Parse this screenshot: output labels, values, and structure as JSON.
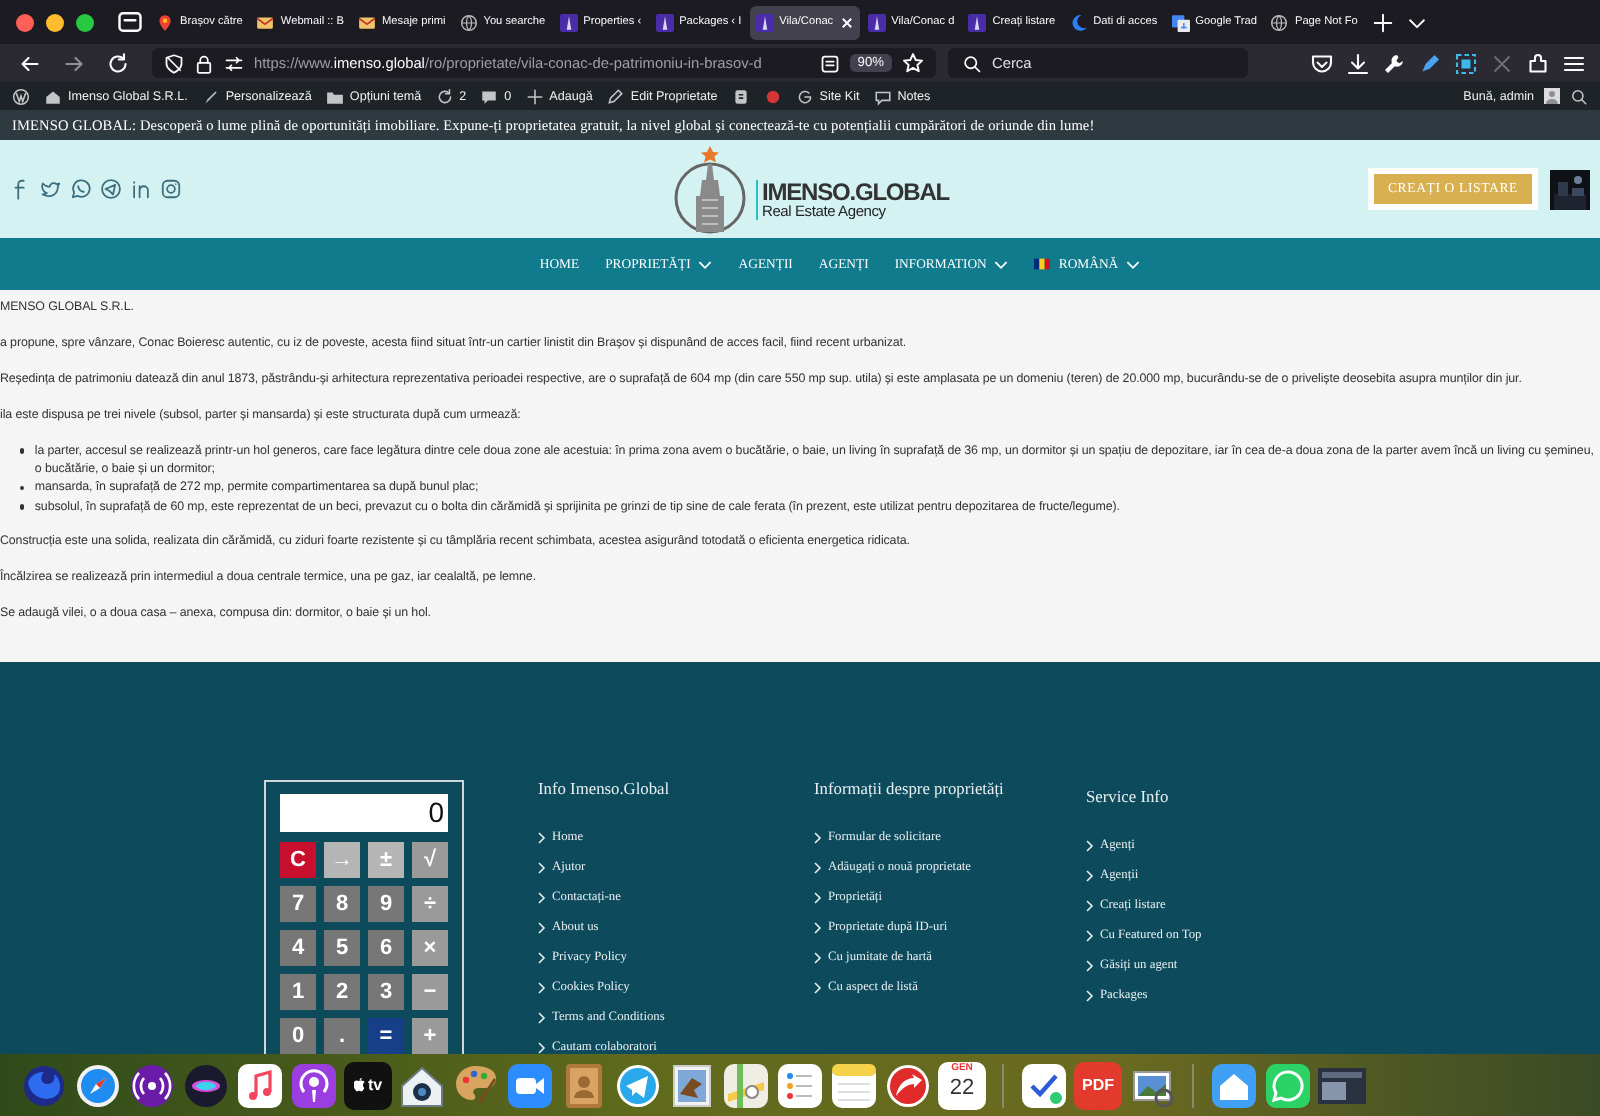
{
  "browser": {
    "tabs": [
      {
        "title": "Brașov către",
        "selected": false
      },
      {
        "title": "Webmail :: B",
        "selected": false
      },
      {
        "title": "Mesaje primi",
        "selected": false
      },
      {
        "title": "You searche",
        "selected": false
      },
      {
        "title": "Properties ‹",
        "selected": false
      },
      {
        "title": "Packages ‹ I",
        "selected": false
      },
      {
        "title": "Vila/Conac",
        "selected": true
      },
      {
        "title": "Vila/Conac d",
        "selected": false
      },
      {
        "title": "Creați listare",
        "selected": false
      },
      {
        "title": "Dati di acces",
        "selected": false
      },
      {
        "title": "Google Trad",
        "selected": false
      },
      {
        "title": "Page Not Fo",
        "selected": false
      }
    ],
    "url": "https://www.**imenso.global**/ro/proprietate/vila-conac-de-patrimoniu-in-brasov-d",
    "zoom": "90%",
    "search": {
      "placeholder": "Cerca"
    }
  },
  "admin_bar": {
    "items": [
      {
        "kind": "wordpress"
      },
      {
        "kind": "site",
        "label": "Imenso Global S.R.L."
      },
      {
        "kind": "customize",
        "label": "Personalizează"
      },
      {
        "kind": "theme",
        "label": "Opțiuni temă"
      },
      {
        "kind": "updates",
        "label": "2"
      },
      {
        "kind": "comments",
        "label": "0"
      },
      {
        "kind": "new",
        "label": "Adaugă"
      },
      {
        "kind": "edit",
        "label": "Edit Proprietate"
      },
      {
        "kind": "plugin"
      },
      {
        "kind": "status"
      },
      {
        "kind": "sitekit",
        "label": "Site Kit"
      },
      {
        "kind": "notes",
        "label": "Notes"
      }
    ],
    "greeting": "Bună, admin"
  },
  "announcement": "IMENSO GLOBAL: Descoperă o lume plină de oportunități imobiliare. Expune-ți proprietatea gratuit, la nivel global și conectează-te cu potențialii cumpărători de oriunde din lume!",
  "header": {
    "social": [
      {
        "kind": "facebook"
      },
      {
        "kind": "twitter"
      },
      {
        "kind": "whatsapp"
      },
      {
        "kind": "telegram"
      },
      {
        "kind": "linkedin"
      },
      {
        "kind": "instagram"
      }
    ],
    "logo": {
      "title": "IMENSO.GLOBAL",
      "subtitle": "Real Estate Agency"
    },
    "button": "CREAȚI O LISTARE"
  },
  "nav": [
    {
      "label": "HOME",
      "dropdown": false,
      "kind": "link"
    },
    {
      "label": "PROPRIETĂȚI",
      "dropdown": true,
      "kind": "link"
    },
    {
      "label": "AGENȚII",
      "dropdown": false,
      "kind": "link"
    },
    {
      "label": "AGENȚI",
      "dropdown": false,
      "kind": "link"
    },
    {
      "label": "INFORMATION",
      "dropdown": true,
      "kind": "link"
    },
    {
      "label": "ROMÂNĂ",
      "dropdown": true,
      "kind": "language"
    }
  ],
  "content": [
    {
      "kind": "paragraph",
      "text": "MENSO GLOBAL S.R.L."
    },
    {
      "kind": "paragraph",
      "text": "a propune, spre vânzare, Conac Boieresc autentic, cu iz de poveste, acesta fiind situat într-un cartier linistit din Brașov și dispunând de acces facil, fiind recent urbanizat."
    },
    {
      "kind": "paragraph",
      "text": "Reședința de patrimoniu datează din anul 1873, păstrându-și arhitectura reprezentativa perioadei respective, are o suprafață de 604 mp (din care 550 mp sup. utila) și este amplasata pe un domeniu (teren) de 20.000 mp, bucurându-se de o priveliște deosebita asupra munților din jur."
    },
    {
      "kind": "paragraph",
      "text": "ila este dispusa pe trei nivele (subsol, parter și mansarda) și este structurata după cum urmează:"
    },
    {
      "kind": "list",
      "items": [
        "la parter, accesul se realizează printr-un hol generos, care face legătura dintre cele doua zone ale acestuia: în prima zona avem o bucătărie, o baie, un living în suprafață de 36 mp, un dormitor și un spațiu de depozitare, iar în cea de-a doua zona de la parter avem încă un living cu șemineu, o bucătărie, o baie și un dormitor;",
        "mansarda, în suprafață de 272 mp, permite compartimentarea sa după bunul plac;",
        "subsolul, în suprafață de 60 mp, este reprezentat de un beci, prevazut cu o bolta din cărămidă și sprijinita pe grinzi de tip sine de cale ferata (în prezent, este utilizat pentru depozitarea de fructe/legume)."
      ]
    },
    {
      "kind": "paragraph",
      "text": "Construcția este una solida, realizata din cărămidă, cu ziduri foarte rezistente și cu tâmplăria recent schimbata, acestea asigurând totodată o eficienta energetica ridicata."
    },
    {
      "kind": "paragraph",
      "text": "Încălzirea se realizează prin intermediul a doua centrale termice, una pe gaz, iar cealaltă, pe lemne."
    },
    {
      "kind": "paragraph",
      "text": "Se adaugă vilei, o a doua casa – anexa, compusa din: dormitor, o baie și un hol."
    }
  ],
  "footer": {
    "calculator": {
      "display": "0",
      "keys": [
        {
          "label": "C",
          "kind": "clear"
        },
        {
          "label": "→",
          "kind": "function"
        },
        {
          "label": "±",
          "kind": "function"
        },
        {
          "label": "√",
          "kind": "operator"
        },
        {
          "label": "7",
          "kind": "digit"
        },
        {
          "label": "8",
          "kind": "digit"
        },
        {
          "label": "9",
          "kind": "digit"
        },
        {
          "label": "÷",
          "kind": "operator"
        },
        {
          "label": "4",
          "kind": "digit"
        },
        {
          "label": "5",
          "kind": "digit"
        },
        {
          "label": "6",
          "kind": "digit"
        },
        {
          "label": "×",
          "kind": "operator"
        },
        {
          "label": "1",
          "kind": "digit"
        },
        {
          "label": "2",
          "kind": "digit"
        },
        {
          "label": "3",
          "kind": "digit"
        },
        {
          "label": "−",
          "kind": "operator"
        },
        {
          "label": "0",
          "kind": "digit"
        },
        {
          "label": ".",
          "kind": "digit"
        },
        {
          "label": "=",
          "kind": "equals"
        },
        {
          "label": "+",
          "kind": "operator"
        }
      ]
    },
    "columns": [
      {
        "title": "Info Imenso.Global",
        "links": [
          "Home",
          "Ajutor",
          "Contactați-ne",
          "About us",
          "Privacy Policy",
          "Cookies Policy",
          "Terms and Conditions",
          "Cautam colaboratori"
        ]
      },
      {
        "title": "Informații despre proprietăți",
        "links": [
          "Formular de solicitare",
          "Adăugați o nouă proprietate",
          "Proprietăți",
          "Proprietate după ID-uri",
          "Cu jumitate de hartă",
          "Cu aspect de listă"
        ]
      },
      {
        "title": "Service Info",
        "links": [
          "Agenți",
          "Agenții",
          "Creați listare",
          "Cu Featured on Top",
          "Găsiți un agent",
          "Packages"
        ]
      }
    ]
  },
  "dock": [
    {
      "kind": "firefox"
    },
    {
      "kind": "safari"
    },
    {
      "kind": "radio"
    },
    {
      "kind": "siri"
    },
    {
      "kind": "music"
    },
    {
      "kind": "podcasts"
    },
    {
      "kind": "tv",
      "label": "tv"
    },
    {
      "kind": "homecam"
    },
    {
      "kind": "palette"
    },
    {
      "kind": "zoom"
    },
    {
      "kind": "contacts"
    },
    {
      "kind": "telegram"
    },
    {
      "kind": "mail"
    },
    {
      "kind": "maps"
    },
    {
      "kind": "reminders"
    },
    {
      "kind": "notes"
    },
    {
      "kind": "arrow"
    },
    {
      "kind": "calendar",
      "month": "GEN",
      "day": "22"
    },
    {
      "kind": "separator"
    },
    {
      "kind": "tasks"
    },
    {
      "kind": "pdf",
      "label": "PDF"
    },
    {
      "kind": "preview"
    },
    {
      "kind": "separator"
    },
    {
      "kind": "home"
    },
    {
      "kind": "whatsapp"
    },
    {
      "kind": "window"
    }
  ]
}
